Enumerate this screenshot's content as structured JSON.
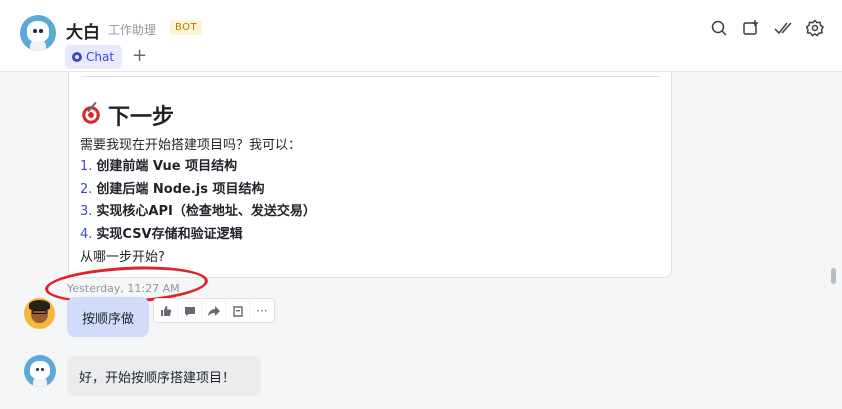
{
  "header": {
    "name": "大白",
    "subtitle": "工作助理",
    "badge": "BOT",
    "tabs": [
      {
        "label": "Chat",
        "active": true
      }
    ],
    "add_tab_label": "+",
    "actions": [
      "search-icon",
      "new-window-icon",
      "done-icon",
      "settings-icon"
    ]
  },
  "message": {
    "heading": "下一步",
    "intro": "需要我现在开始搭建项目吗？我可以：",
    "steps": [
      {
        "num": "1.",
        "text": "创建前端 Vue 项目结构"
      },
      {
        "num": "2.",
        "text": "创建后端 Node.js 项目结构"
      },
      {
        "num": "3.",
        "text": "实现核心API（检查地址、发送交易）"
      },
      {
        "num": "4.",
        "text": "实现CSV存储和验证逻辑"
      }
    ],
    "outro": "从哪一步开始?",
    "timestamp": "Yesterday, 11:27 AM"
  },
  "user_message": {
    "text": "按顺序做"
  },
  "message_actions": {
    "more_label": "···"
  },
  "bot_reply": {
    "text": "好，开始按顺序搭建项目！"
  },
  "colors": {
    "accent": "#3c4ad6",
    "user_bubble": "#d1dcfb",
    "highlight": "#e0202a"
  }
}
